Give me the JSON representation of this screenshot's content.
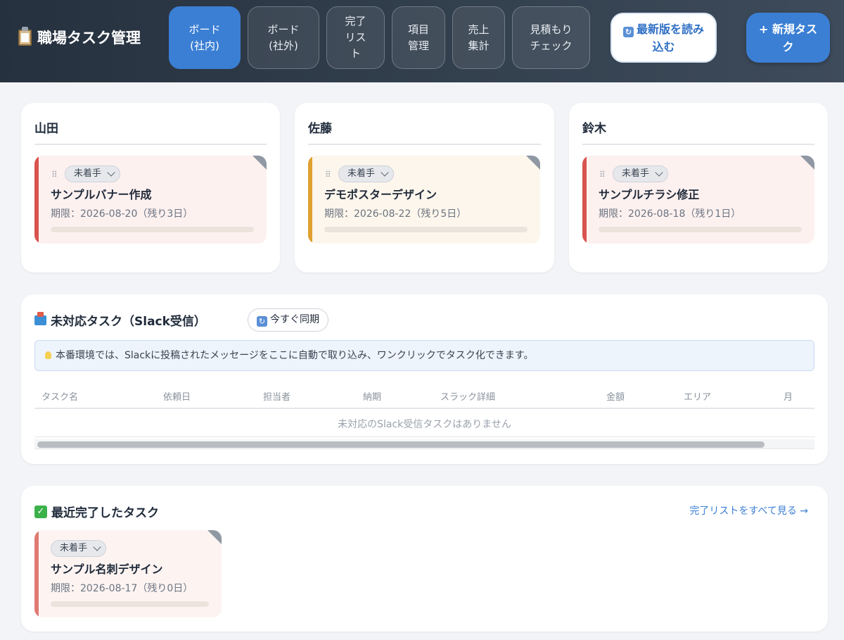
{
  "header": {
    "title": "職場タスク管理",
    "nav": [
      {
        "label": "ボード\n(社内)",
        "active": true
      },
      {
        "label": "ボード\n(社外)",
        "active": false
      },
      {
        "label": "完了\nリス\nト",
        "active": false
      },
      {
        "label": "項目\n管理",
        "active": false
      },
      {
        "label": "売上\n集計",
        "active": false
      },
      {
        "label": "見積もり\nチェック",
        "active": false
      }
    ],
    "reload_label": "最新版を読み込む",
    "new_task_label": "+ 新規タスク"
  },
  "board": {
    "columns": [
      {
        "name": "山田",
        "task": {
          "status": "未着手",
          "title": "サンプルバナー作成",
          "due": "期限：2026-08-20（残り3日）",
          "accent": "#d9534f",
          "bg": "#fdf1f0"
        }
      },
      {
        "name": "佐藤",
        "task": {
          "status": "未着手",
          "title": "デモポスターデザイン",
          "due": "期限：2026-08-22（残り5日）",
          "accent": "#e0a030",
          "bg": "#fdf6ec"
        }
      },
      {
        "name": "鈴木",
        "task": {
          "status": "未着手",
          "title": "サンプルチラシ修正",
          "due": "期限：2026-08-18（残り1日）",
          "accent": "#d9534f",
          "bg": "#fdf1f0"
        }
      }
    ]
  },
  "slack": {
    "title": "未対応タスク（Slack受信）",
    "sync_label": "今すぐ同期",
    "info": "本番環境では、Slackに投稿されたメッセージをここに自動で取り込み、ワンクリックでタスク化できます。",
    "columns": [
      "タスク名",
      "依頼日",
      "担当者",
      "納期",
      "スラック詳細",
      "金額",
      "エリア",
      "月"
    ],
    "empty": "未対応のSlack受信タスクはありません"
  },
  "recent": {
    "title": "最近完了したタスク",
    "link": "完了リストをすべて見る →",
    "task": {
      "status": "未着手",
      "title": "サンプル名刺デザイン",
      "due": "期限：2026-08-17（残り0日）",
      "accent": "#e07a72",
      "bg": "#fdf4f2"
    }
  }
}
